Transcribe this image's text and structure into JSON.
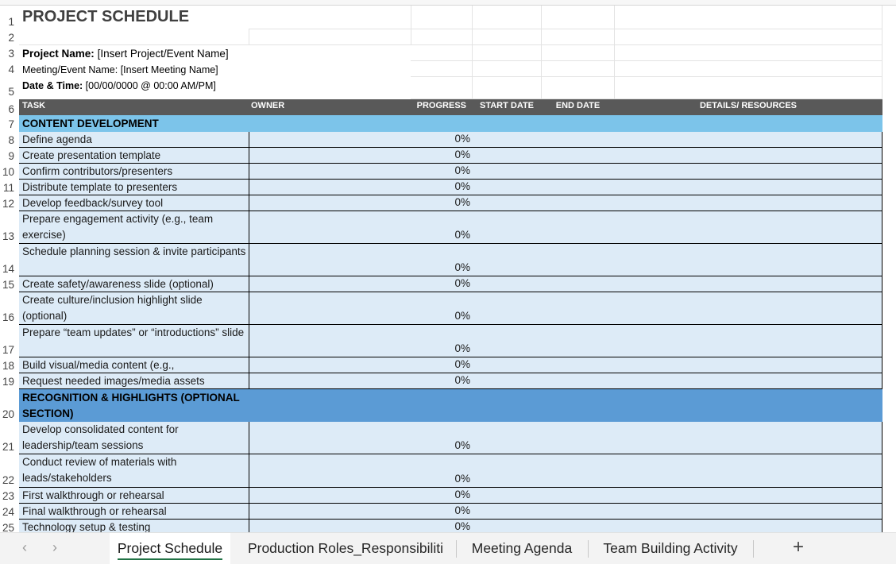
{
  "sheet": {
    "title": "PROJECT SCHEDULE",
    "project_name_label": "Project Name:",
    "project_name_value": "[Insert Project/Event Name]",
    "meeting_label": "Meeting/Event Name:",
    "meeting_value": "[Insert Meeting Name]",
    "datetime_label": "Date & Time:",
    "datetime_value": "[00/00/0000 @ 00:00 AM/PM]",
    "row_numbers": [
      "1",
      "2",
      "3",
      "4",
      "5",
      "6",
      "7",
      "8",
      "9",
      "10",
      "11",
      "12",
      "13",
      "14",
      "15",
      "16",
      "17",
      "18",
      "19",
      "20",
      "21",
      "22",
      "23",
      "24",
      "25"
    ],
    "headers": {
      "task": "TASK",
      "owner": "OWNER",
      "progress": "PROGRESS",
      "start": "START DATE",
      "end": "END DATE",
      "details": "DETAILS/ RESOURCES"
    },
    "sections": [
      {
        "name": "CONTENT DEVELOPMENT",
        "tasks": [
          {
            "task": "Define agenda",
            "progress": "0%"
          },
          {
            "task": "Create presentation template",
            "progress": "0%"
          },
          {
            "task": "Confirm contributors/presenters",
            "progress": "0%"
          },
          {
            "task": "Distribute template to presenters",
            "progress": "0%"
          },
          {
            "task": "Develop feedback/survey tool",
            "progress": "0%"
          },
          {
            "task": "Prepare engagement activity (e.g., team exercise)",
            "progress": "0%"
          },
          {
            "task": "Schedule planning session & invite participants",
            "progress": "0%"
          },
          {
            "task": "Create safety/awareness slide (optional)",
            "progress": "0%"
          },
          {
            "task": "Create culture/inclusion highlight slide (optional)",
            "progress": "0%"
          },
          {
            "task": "Prepare “team updates” or “introductions” slide",
            "progress": "0%"
          },
          {
            "task": "Build visual/media content (e.g.,",
            "progress": "0%"
          },
          {
            "task": "Request needed images/media assets",
            "progress": "0%"
          }
        ]
      },
      {
        "name": "RECOGNITION & HIGHLIGHTS (OPTIONAL SECTION)",
        "tasks": [
          {
            "task": "Develop consolidated content for leadership/team sessions",
            "progress": "0%"
          },
          {
            "task": "Conduct review of materials with leads/stakeholders",
            "progress": "0%"
          },
          {
            "task": "First walkthrough or rehearsal",
            "progress": "0%"
          },
          {
            "task": "Final walkthrough or rehearsal",
            "progress": "0%"
          },
          {
            "task": "Technology setup & testing",
            "progress": "0%"
          }
        ]
      }
    ]
  },
  "tabs": {
    "items": [
      {
        "label": "Project Schedule",
        "active": true
      },
      {
        "label": "Production Roles_Responsibiliti",
        "active": false
      },
      {
        "label": "Meeting Agenda",
        "active": false
      },
      {
        "label": "Team Building Activity",
        "active": false
      }
    ],
    "add_label": "+",
    "prev_icon": "chevron-left-icon",
    "next_icon": "chevron-right-icon"
  },
  "colors": {
    "header_bg": "#595959",
    "section1_bg": "#7cc4ea",
    "section2_bg": "#5b9bd5",
    "row_bg": "#ddebf7",
    "active_tab_accent": "#217346"
  }
}
